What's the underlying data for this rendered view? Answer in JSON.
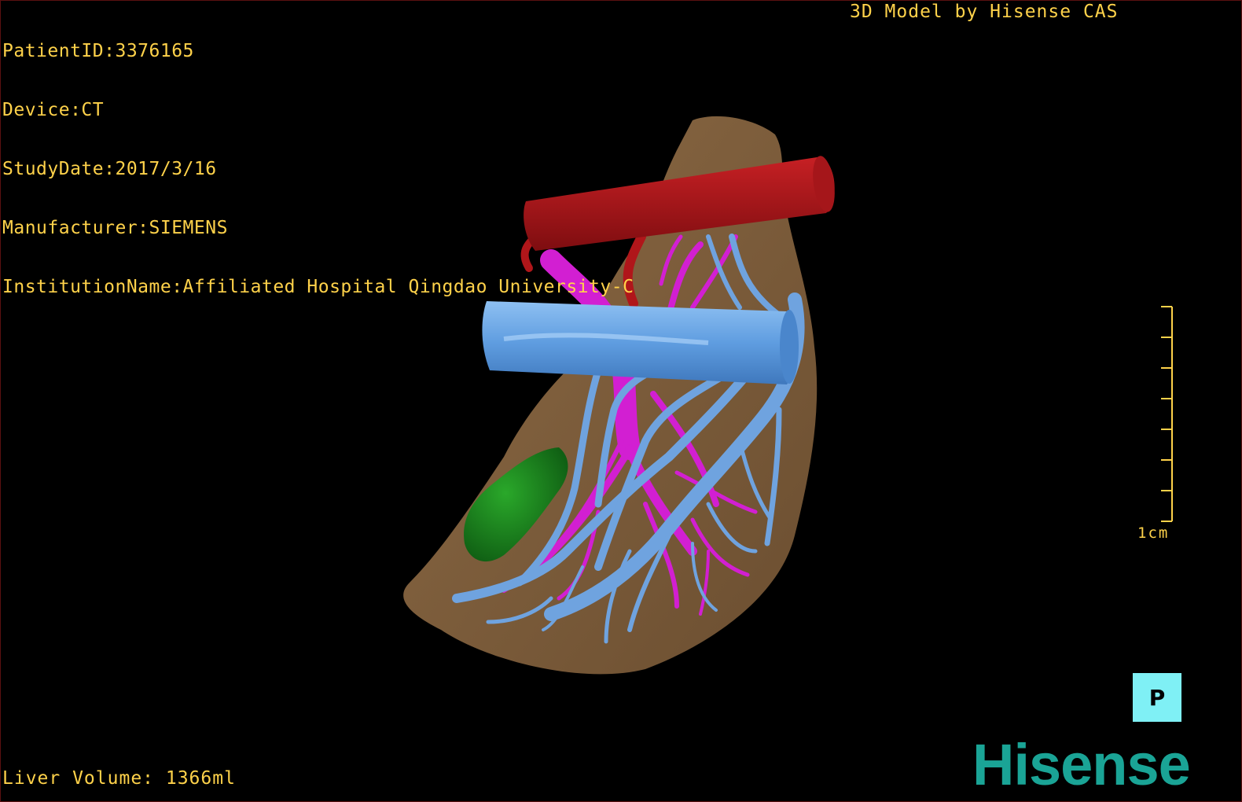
{
  "header": {
    "patient_id": "PatientID:3376165",
    "device": "Device:CT",
    "study_date": "StudyDate:2017/3/16",
    "manufacturer": "Manufacturer:SIEMENS",
    "institution": "InstitutionName:Affiliated Hospital Qingdao University-C"
  },
  "credit": "3D Model by Hisense CAS",
  "footer": {
    "liver_volume": "Liver Volume: 1366ml"
  },
  "scale": {
    "label": "1cm",
    "ticks": 8
  },
  "orientation": {
    "label": "P"
  },
  "logo": {
    "text": "Hisense"
  },
  "colors": {
    "liver": "#7a5a38",
    "artery_trunk": "#b0161a",
    "portal_vein": "#d21fd2",
    "hepatic_vein": "#6fa3df",
    "gallbladder": "#1f8a1f",
    "text": "#ffd24a",
    "logo": "#1aa496",
    "orientation_box": "#7ff0f5"
  }
}
